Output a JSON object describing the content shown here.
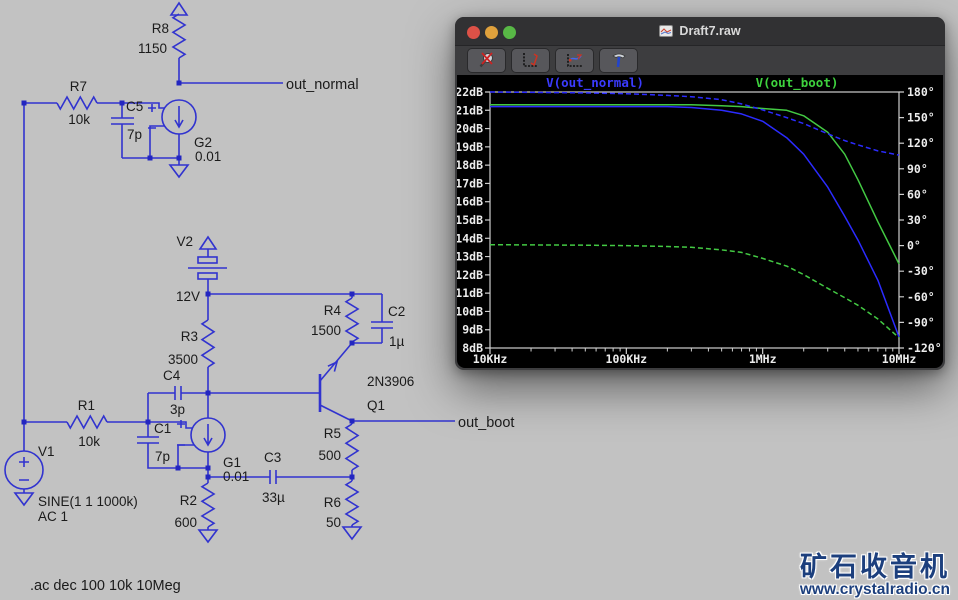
{
  "window": {
    "title": "Draft7.raw",
    "toolbar_icons": [
      "zoom-reset-icon",
      "autorange-icon",
      "plot-settings-icon",
      "control-panel-icon"
    ]
  },
  "chart_data": {
    "type": "line",
    "title": "",
    "x_axis": {
      "scale": "log",
      "range_hz": [
        10000,
        10000000
      ],
      "tick_labels": [
        "10KHz",
        "100KHz",
        "1MHz",
        "10MHz"
      ]
    },
    "y_left_axis": {
      "unit": "dB",
      "max": 22,
      "min": 8,
      "step": 1,
      "tick_labels": [
        "22dB",
        "21dB",
        "20dB",
        "19dB",
        "18dB",
        "17dB",
        "16dB",
        "15dB",
        "14dB",
        "13dB",
        "12dB",
        "11dB",
        "10dB",
        "9dB",
        "8dB"
      ]
    },
    "y_right_axis": {
      "unit": "°",
      "max": 180,
      "min": -120,
      "step": 30,
      "tick_labels": [
        "180°",
        "150°",
        "120°",
        "90°",
        "60°",
        "30°",
        "0°",
        "-30°",
        "-60°",
        "-90°",
        "-120°"
      ]
    },
    "legend": [
      {
        "label": "V(out_normal)",
        "color": "#3b3bff"
      },
      {
        "label": "V(out_boot)",
        "color": "#3ed23e"
      }
    ],
    "freqs_hz": [
      10000,
      20000,
      50000,
      100000,
      200000,
      300000,
      500000,
      700000,
      1000000,
      1500000,
      2000000,
      3000000,
      4000000,
      5000000,
      7000000,
      10000000
    ],
    "series": [
      {
        "name": "V(out_normal) magnitude",
        "axis": "left",
        "style": "solid",
        "color": "#2b2bff",
        "values": [
          21.2,
          21.2,
          21.2,
          21.2,
          21.2,
          21.15,
          21.0,
          20.8,
          20.4,
          19.5,
          18.6,
          16.8,
          15.2,
          13.9,
          11.7,
          8.6
        ]
      },
      {
        "name": "V(out_boot) magnitude",
        "axis": "left",
        "style": "solid",
        "color": "#43c943",
        "values": [
          21.3,
          21.3,
          21.3,
          21.3,
          21.3,
          21.3,
          21.25,
          21.2,
          21.1,
          21.0,
          20.7,
          19.8,
          18.6,
          17.2,
          14.9,
          12.6
        ]
      },
      {
        "name": "V(out_normal) phase",
        "axis": "right",
        "style": "dashed",
        "color": "#2b2bff",
        "values": [
          180,
          179.5,
          179,
          178,
          176,
          174.5,
          171,
          166,
          159,
          150,
          143,
          131,
          123,
          118,
          111,
          106
        ]
      },
      {
        "name": "V(out_boot) phase",
        "axis": "right",
        "style": "dashed",
        "color": "#43c943",
        "values": [
          1,
          0.8,
          0.5,
          0,
          -1,
          -2,
          -5,
          -8,
          -15,
          -24,
          -34,
          -50,
          -61,
          -70,
          -86,
          -108
        ]
      }
    ]
  },
  "schematic": {
    "r8": {
      "ref": "R8",
      "val": "1150"
    },
    "r7": {
      "ref": "R7",
      "val": "10k"
    },
    "c5": {
      "ref": "C5",
      "val": "7p"
    },
    "g2": {
      "ref": "G2",
      "val": "0.01"
    },
    "v2": {
      "ref": "V2",
      "val": "12V"
    },
    "r3": {
      "ref": "R3",
      "val": "3500"
    },
    "r4": {
      "ref": "R4",
      "val": "1500"
    },
    "c2": {
      "ref": "C2",
      "val": "1µ"
    },
    "c4": {
      "ref": "C4",
      "val": "3p"
    },
    "c1": {
      "ref": "C1",
      "val": "7p"
    },
    "g1": {
      "ref": "G1",
      "val": "0.01"
    },
    "r1": {
      "ref": "R1",
      "val": "10k"
    },
    "r2": {
      "ref": "R2",
      "val": "600"
    },
    "r5": {
      "ref": "R5",
      "val": "500"
    },
    "r6": {
      "ref": "R6",
      "val": "50"
    },
    "c3": {
      "ref": "C3",
      "val": "33µ"
    },
    "q1": {
      "ref": "Q1",
      "val": "2N3906"
    },
    "v1": {
      "ref": "V1",
      "line1": "SINE(1 1 1000k)",
      "line2": "AC 1"
    },
    "nets": {
      "out_normal": "out_normal",
      "out_boot": "out_boot"
    },
    "directive": ".ac dec 100 10k 10Meg"
  },
  "watermark": {
    "title": "矿石收音机",
    "url": "www.crystalradio.cn"
  }
}
